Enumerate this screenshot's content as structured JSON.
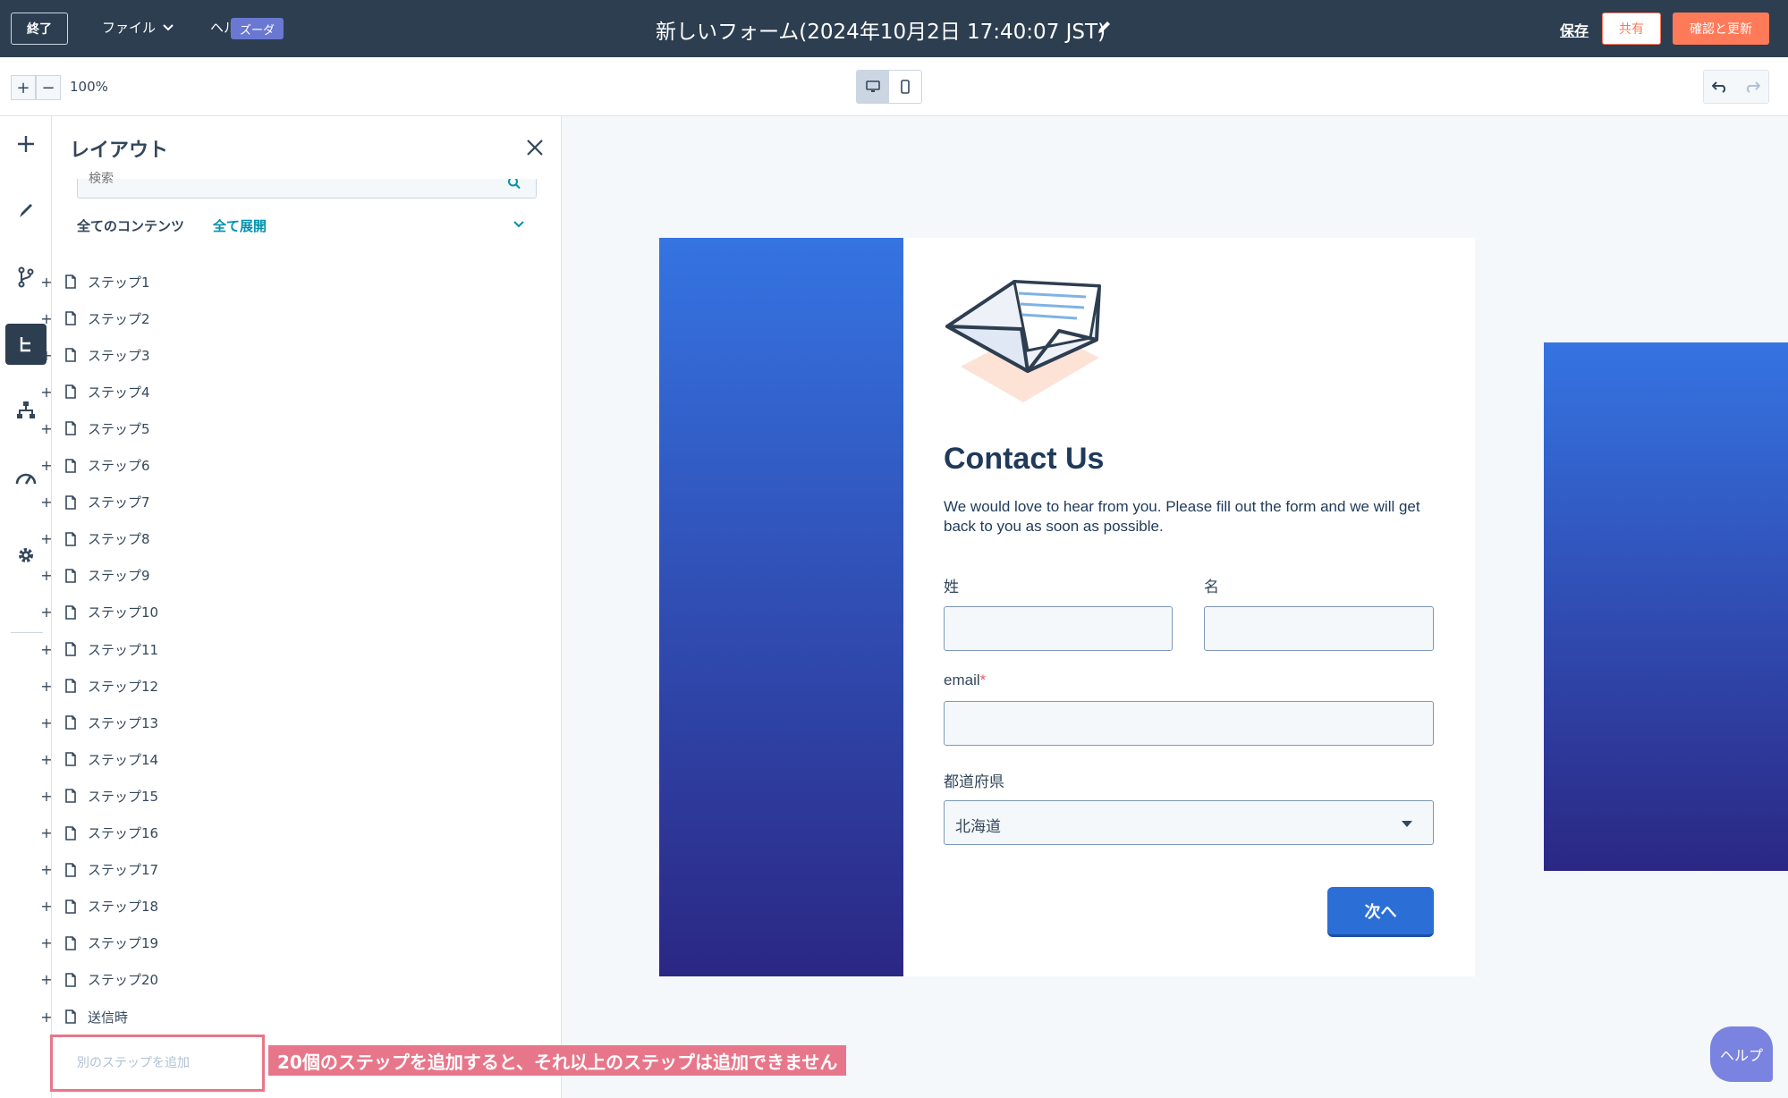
{
  "topbar": {
    "exit_label": "終了",
    "file_menu_label": "ファイル",
    "help_menu_label": "ヘル",
    "beta_label": "ズーダ",
    "title": "新しいフォーム(2024年10月2日 17:40:07 JST)",
    "save_label": "保存",
    "share_label": "共有",
    "review_label": "確認と更新"
  },
  "toolbar": {
    "zoom_in": "+",
    "zoom_out": "−",
    "zoom_level": "100%"
  },
  "rail": {
    "icons": [
      "plus-icon",
      "brush-icon",
      "branch-icon",
      "tree-icon",
      "sitemap-icon",
      "gauge-icon",
      "gear-icon"
    ]
  },
  "panel": {
    "title": "レイアウト",
    "search_placeholder": "検索",
    "all_content_label": "全てのコンテンツ",
    "expand_all_label": "全て展開",
    "steps": [
      "ステップ1",
      "ステップ2",
      "ステップ3",
      "ステップ4",
      "ステップ5",
      "ステップ6",
      "ステップ7",
      "ステップ8",
      "ステップ9",
      "ステップ10",
      "ステップ11",
      "ステップ12",
      "ステップ13",
      "ステップ14",
      "ステップ15",
      "ステップ16",
      "ステップ17",
      "ステップ18",
      "ステップ19",
      "ステップ20",
      "送信時"
    ],
    "add_step_label": "別のステップを追加",
    "note": "20個のステップを追加すると、それ以上のステップは追加できません"
  },
  "form": {
    "heading": "Contact Us",
    "description": "We would love to hear from you. Please fill out the form and we will get back to you as soon as possible.",
    "last_name_label": "姓",
    "first_name_label": "名",
    "email_label": "email",
    "required_mark": "*",
    "prefecture_label": "都道府県",
    "prefecture_value": "北海道",
    "next_label": "次へ"
  },
  "help_label": "ヘルプ",
  "colors": {
    "topbar": "#2d3e50",
    "accent_orange": "#ff7a59",
    "link_teal": "#0091ae",
    "gradient_top": "#3574e2",
    "gradient_bottom": "#2b2784",
    "annotation_pink": "#e8768a"
  }
}
